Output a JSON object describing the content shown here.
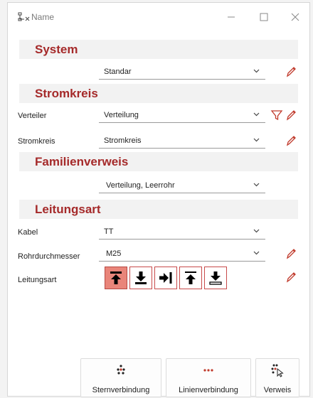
{
  "window": {
    "title": "Name"
  },
  "sections": {
    "system": "System",
    "stromkreis": "Stromkreis",
    "familienverweis": "Familienverweis",
    "leitungsart": "Leitungsart"
  },
  "fields": {
    "system_value": "Standar",
    "verteiler_label": "Verteiler",
    "verteiler_value": "Verteilung",
    "stromkreis_label": "Stromkreis",
    "stromkreis_value": "Stromkreis",
    "familienverweis_value": "Verteilung, Leerrohr",
    "kabel_label": "Kabel",
    "kabel_value": "TT",
    "rohr_label": "Rohrdurchmesser",
    "rohr_value": "M25",
    "leitungsart_label": "Leitungsart"
  },
  "leitungsart_options": [
    "arrow-up-bar-icon",
    "arrow-down-bar-icon",
    "arrow-right-bar-icon",
    "arrow-up-outline-icon",
    "arrow-down-outline-icon"
  ],
  "leitungsart_selected": 0,
  "buttons": {
    "stern": "Sternverbindung",
    "linien": "Linienverbindung",
    "verweis": "Verweis"
  },
  "colors": {
    "accent": "#a52a2a",
    "selected": "#e9857a",
    "icon_red": "#c0392b"
  }
}
